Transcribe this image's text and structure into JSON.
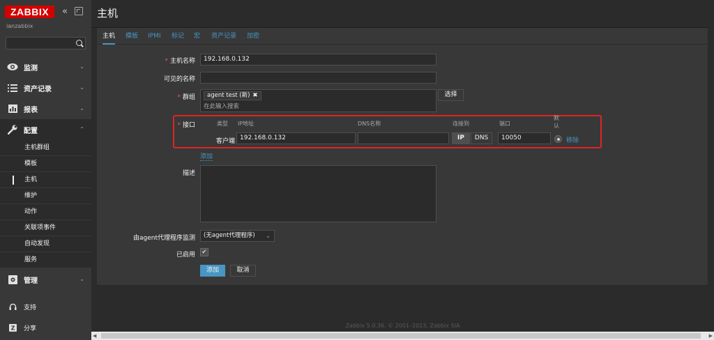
{
  "app": {
    "logo": "ZABBIX",
    "server_name": "ianzabbix",
    "collapse_glyph": "«",
    "search_placeholder": ""
  },
  "sidebar": {
    "menus": [
      {
        "id": "monitoring",
        "label": "监测",
        "icon": "eye-icon"
      },
      {
        "id": "inventory",
        "label": "资产记录",
        "icon": "list-icon"
      },
      {
        "id": "reports",
        "label": "报表",
        "icon": "bar-chart-icon"
      },
      {
        "id": "configuration",
        "label": "配置",
        "icon": "wrench-icon"
      },
      {
        "id": "administration",
        "label": "管理",
        "icon": "gear-icon"
      },
      {
        "id": "support",
        "label": "支持",
        "icon": "headset-icon"
      },
      {
        "id": "share",
        "label": "分享",
        "icon": "share-icon"
      }
    ],
    "config_submenu": [
      "主机群组",
      "模板",
      "主机",
      "维护",
      "动作",
      "关联项事件",
      "自动发现",
      "服务"
    ],
    "selected_submenu": "主机"
  },
  "header": {
    "title": "主机"
  },
  "tabs": [
    "主机",
    "模板",
    "IPMI",
    "标记",
    "宏",
    "资产记录",
    "加密"
  ],
  "active_tab": "主机",
  "form": {
    "host_name_label": "主机名称",
    "host_name_value": "192.168.0.132",
    "visible_name_label": "可见的名称",
    "visible_name_value": "",
    "groups_label": "群组",
    "group_chip": "agent test (新)",
    "group_chip_remove": "✖",
    "group_placeholder": "在此输入搜索",
    "select_button": "选择",
    "interfaces_label": "接口",
    "iface_columns": {
      "type": "类型",
      "ip": "IP地址",
      "dns": "DNS名称",
      "connect_to": "连接到",
      "port": "端口",
      "default": "默认"
    },
    "iface_row": {
      "type": "客户端",
      "ip": "192.168.0.132",
      "dns": "",
      "connect_ip": "IP",
      "connect_dns": "DNS",
      "port": "10050",
      "remove": "移除"
    },
    "add_interface": "添加",
    "description_label": "描述",
    "description_value": "",
    "proxy_label": "由agent代理程序监测",
    "proxy_value": "(无agent代理程序)",
    "enabled_label": "已启用",
    "enabled_checked": "✔",
    "add_button": "添加",
    "cancel_button": "取消"
  },
  "footer": {
    "text": "Zabbix 5.0.36. © 2001–2023, Zabbix SIA"
  }
}
